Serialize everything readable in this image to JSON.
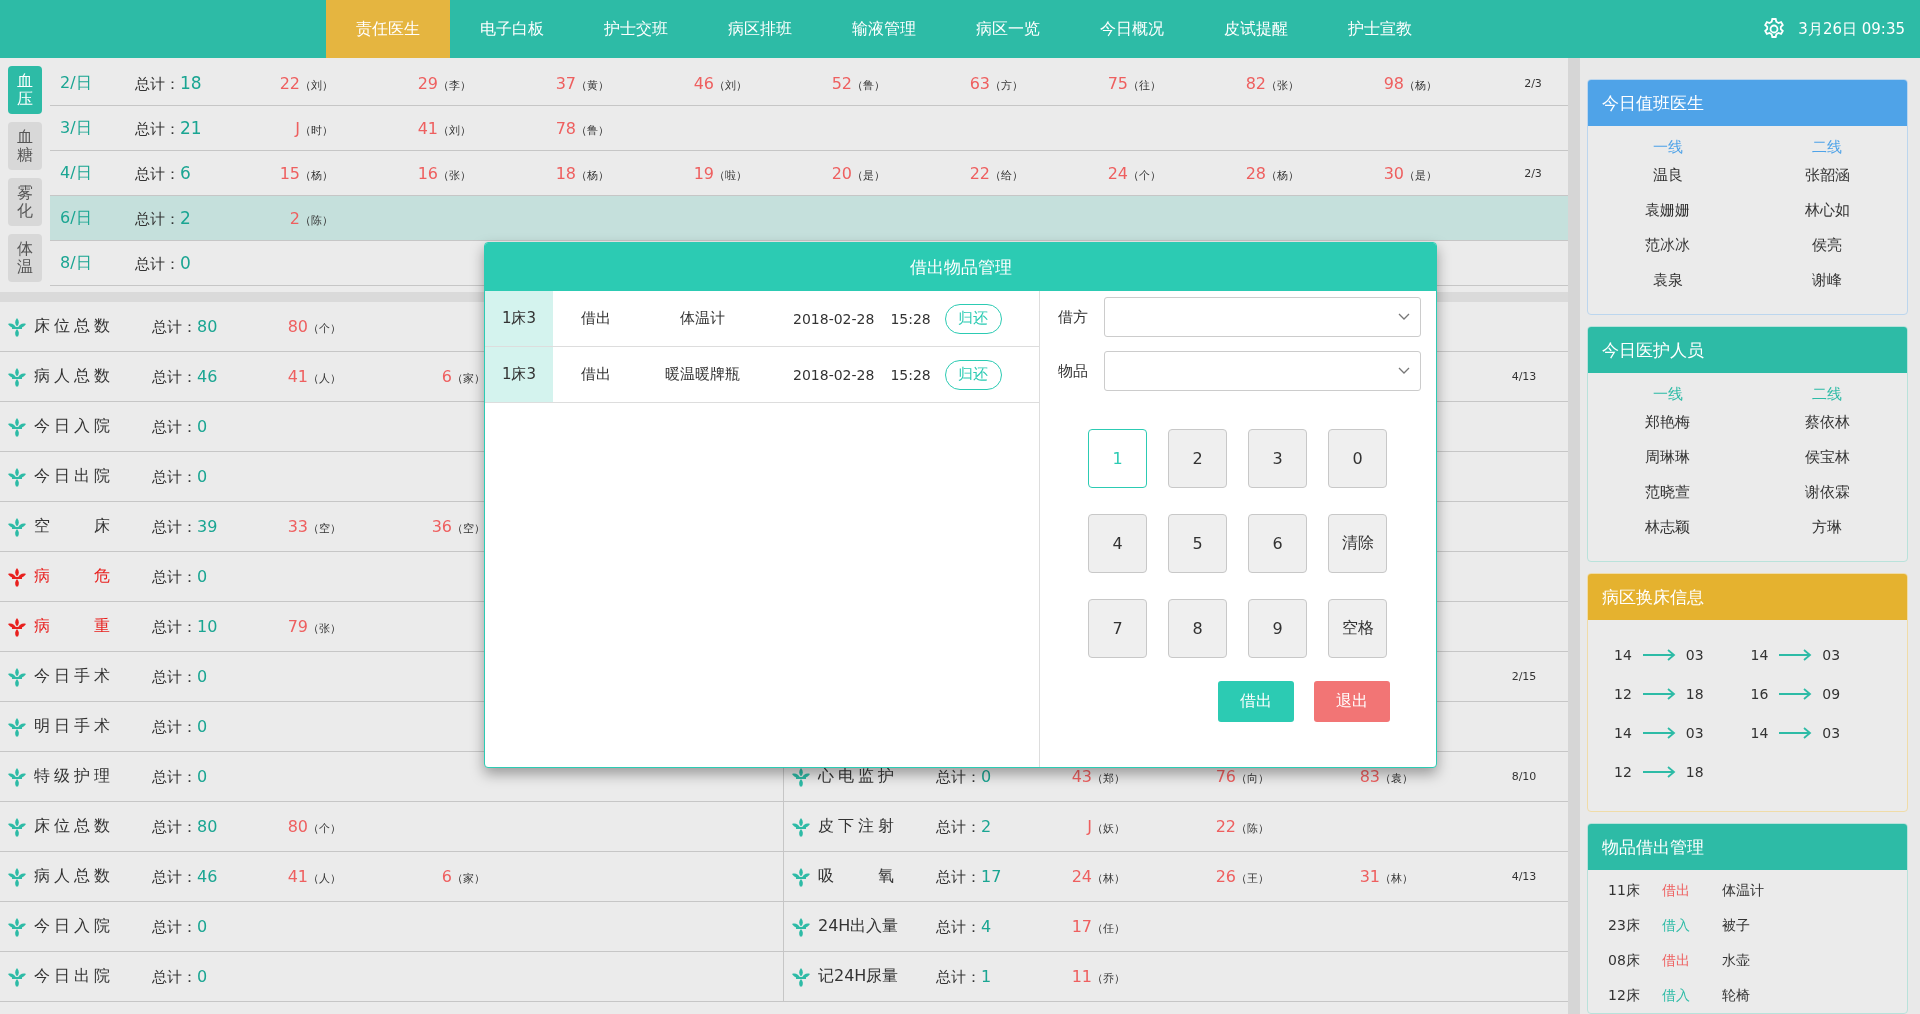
{
  "nav": {
    "tabs": [
      {
        "label": "责任医生",
        "selected": true
      },
      {
        "label": "电子白板",
        "selected": false
      },
      {
        "label": "护士交班",
        "selected": false
      },
      {
        "label": "病区排班",
        "selected": false
      },
      {
        "label": "输液管理",
        "selected": false
      },
      {
        "label": "病区一览",
        "selected": false
      },
      {
        "label": "今日概况",
        "selected": false
      },
      {
        "label": "皮试提醒",
        "selected": false
      },
      {
        "label": "护士宣教",
        "selected": false
      }
    ],
    "datetime": "3月26日 09:35"
  },
  "vitals": {
    "tabs": [
      {
        "label": "血压",
        "selected": true
      },
      {
        "label": "血糖",
        "selected": false
      },
      {
        "label": "雾化",
        "selected": false
      },
      {
        "label": "体温",
        "selected": false
      }
    ],
    "rows": [
      {
        "day": "2/日",
        "total_label": "总计：",
        "total": "18",
        "selected": false,
        "entries": [
          {
            "value": "22",
            "name": "（刘）"
          },
          {
            "value": "29",
            "name": "（李）"
          },
          {
            "value": "37",
            "name": "（黄）"
          },
          {
            "value": "46",
            "name": "（刘）"
          },
          {
            "value": "52",
            "name": "（鲁）"
          },
          {
            "value": "63",
            "name": "（方）"
          },
          {
            "value": "75",
            "name": "（往）"
          },
          {
            "value": "82",
            "name": "（张）"
          },
          {
            "value": "98",
            "name": "（杨）"
          }
        ],
        "page": "2/3"
      },
      {
        "day": "3/日",
        "total_label": "总计：",
        "total": "21",
        "selected": false,
        "entries": [
          {
            "value": "J",
            "name": "（时）"
          },
          {
            "value": "41",
            "name": "（刘）"
          },
          {
            "value": "78",
            "name": "（鲁）"
          }
        ]
      },
      {
        "day": "4/日",
        "total_label": "总计：",
        "total": "6",
        "selected": false,
        "entries": [
          {
            "value": "15",
            "name": "（杨）"
          },
          {
            "value": "16",
            "name": "（张）"
          },
          {
            "value": "18",
            "name": "（杨）"
          },
          {
            "value": "19",
            "name": "（啦）"
          },
          {
            "value": "20",
            "name": "（是）"
          },
          {
            "value": "22",
            "name": "（给）"
          },
          {
            "value": "24",
            "name": "（个）"
          },
          {
            "value": "28",
            "name": "（杨）"
          },
          {
            "value": "30",
            "name": "（是）"
          }
        ],
        "page": "2/3"
      },
      {
        "day": "6/日",
        "total_label": "总计：",
        "total": "2",
        "selected": true,
        "entries": [
          {
            "value": "2",
            "name": "（陈）"
          }
        ]
      },
      {
        "day": "8/日",
        "total_label": "总计：",
        "total": "0",
        "selected": false,
        "entries": []
      }
    ]
  },
  "summary": {
    "columns": [
      {
        "rows": [
          {
            "name": "床位总数",
            "critical": false,
            "total_label": "总计：",
            "total": "80",
            "entries": [
              {
                "value": "80",
                "name": "（个）"
              }
            ]
          },
          {
            "name": "病人总数",
            "critical": false,
            "total_label": "总计：",
            "total": "46",
            "entries": [
              {
                "value": "41",
                "name": "（人）"
              },
              {
                "value": "6",
                "name": "（家）"
              }
            ]
          },
          {
            "name": "今日入院",
            "critical": false,
            "total_label": "总计：",
            "total": "0",
            "entries": []
          },
          {
            "name": "今日出院",
            "critical": false,
            "total_label": "总计：",
            "total": "0",
            "entries": []
          },
          {
            "name": "空床",
            "critical": false,
            "total_label": "总计：",
            "total": "39",
            "entries": [
              {
                "value": "33",
                "name": "（空）"
              },
              {
                "value": "36",
                "name": "（空）"
              }
            ]
          },
          {
            "name": "病危",
            "critical": true,
            "total_label": "总计：",
            "total": "0",
            "entries": []
          },
          {
            "name": "病重",
            "critical": true,
            "total_label": "总计：",
            "total": "10",
            "entries": [
              {
                "value": "79",
                "name": "（张）"
              }
            ]
          },
          {
            "name": "今日手术",
            "critical": false,
            "total_label": "总计：",
            "total": "0",
            "entries": []
          },
          {
            "name": "明日手术",
            "critical": false,
            "total_label": "总计：",
            "total": "0",
            "entries": []
          },
          {
            "name": "特级护理",
            "critical": false,
            "total_label": "总计：",
            "total": "0",
            "entries": []
          },
          {
            "name": "床位总数",
            "critical": false,
            "total_label": "总计：",
            "total": "80",
            "entries": [
              {
                "value": "80",
                "name": "（个）"
              }
            ]
          },
          {
            "name": "病人总数",
            "critical": false,
            "total_label": "总计：",
            "total": "46",
            "entries": [
              {
                "value": "41",
                "name": "（人）"
              },
              {
                "value": "6",
                "name": "（家）"
              }
            ]
          },
          {
            "name": "今日入院",
            "critical": false,
            "total_label": "总计：",
            "total": "0",
            "entries": []
          },
          {
            "name": "今日出院",
            "critical": false,
            "total_label": "总计：",
            "total": "0",
            "entries": []
          }
        ]
      },
      {
        "rows": [
          {},
          {
            "page": "4/13"
          },
          {},
          {},
          {},
          {},
          {},
          {
            "page": "2/15"
          },
          {},
          {
            "name": "心电监护",
            "critical": false,
            "total_label": "总计：",
            "total": "0",
            "entries": [
              {
                "value": "43",
                "name": "（郑）"
              },
              {
                "value": "76",
                "name": "（向）"
              },
              {
                "value": "83",
                "name": "（袁）"
              }
            ],
            "page": "8/10"
          },
          {
            "name": "皮下注射",
            "critical": false,
            "total_label": "总计：",
            "total": "2",
            "entries": [
              {
                "value": "J",
                "name": "（妖）"
              },
              {
                "value": "22",
                "name": "（陈）"
              }
            ]
          },
          {
            "name": "吸氧",
            "critical": false,
            "total_label": "总计：",
            "total": "17",
            "entries": [
              {
                "value": "24",
                "name": "（林）"
              },
              {
                "value": "26",
                "name": "（王）"
              },
              {
                "value": "31",
                "name": "（林）"
              }
            ],
            "page": "4/13"
          },
          {
            "name": "24H出入量",
            "critical": false,
            "total_label": "总计：",
            "total": "4",
            "entries": [
              {
                "value": "17",
                "name": "（任）"
              }
            ]
          },
          {
            "name": "记24H尿量",
            "critical": false,
            "total_label": "总计：",
            "total": "1",
            "entries": [
              {
                "value": "11",
                "name": "（乔）"
              }
            ]
          }
        ]
      }
    ]
  },
  "dialog": {
    "title": "借出物品管理",
    "loans": [
      {
        "bed": "1床3",
        "action": "借出",
        "item": "体温计",
        "date": "2018-02-28",
        "time": "15:28",
        "button": "归还"
      },
      {
        "bed": "1床3",
        "action": "借出",
        "item": "暖温暖牌瓶",
        "date": "2018-02-28",
        "time": "15:28",
        "button": "归还"
      }
    ],
    "fields": [
      {
        "label": "借方"
      },
      {
        "label": "物品"
      }
    ],
    "keys": [
      {
        "label": "1",
        "selected": true
      },
      {
        "label": "2",
        "selected": false
      },
      {
        "label": "3",
        "selected": false
      },
      {
        "label": "0",
        "selected": false
      },
      {
        "label": "4",
        "selected": false
      },
      {
        "label": "5",
        "selected": false
      },
      {
        "label": "6",
        "selected": false
      },
      {
        "label": "清除",
        "selected": false
      },
      {
        "label": "7",
        "selected": false
      },
      {
        "label": "8",
        "selected": false
      },
      {
        "label": "9",
        "selected": false
      },
      {
        "label": "空格",
        "selected": false
      }
    ],
    "buttons": [
      {
        "label": "借出",
        "kind": "primary"
      },
      {
        "label": "退出",
        "kind": "danger"
      }
    ]
  },
  "duty_doctors": {
    "title": "今日值班医生",
    "columns": [
      {
        "heading": "一线",
        "names": [
          "温良",
          "袁姗姗",
          "范冰冰",
          "袁泉"
        ]
      },
      {
        "heading": "二线",
        "names": [
          "张韶涵",
          "林心如",
          "侯亮",
          "谢峰"
        ]
      }
    ]
  },
  "staff": {
    "title": "今日医护人员",
    "columns": [
      {
        "heading": "一线",
        "names": [
          "郑艳梅",
          "周琳琳",
          "范晓萱",
          "林志颖"
        ]
      },
      {
        "heading": "二线",
        "names": [
          "蔡依林",
          "侯宝林",
          "谢依霖",
          "方琳"
        ]
      }
    ]
  },
  "bed_changes": {
    "title": "病区换床信息",
    "items": [
      {
        "from": "14",
        "to": "03"
      },
      {
        "from": "14",
        "to": "03"
      },
      {
        "from": "12",
        "to": "18"
      },
      {
        "from": "16",
        "to": "09"
      },
      {
        "from": "14",
        "to": "03"
      },
      {
        "from": "14",
        "to": "03"
      },
      {
        "from": "12",
        "to": "18"
      }
    ]
  },
  "loans": {
    "title": "物品借出管理",
    "items": [
      {
        "bed": "11床",
        "kind": "out",
        "action": "借出",
        "item": "体温计"
      },
      {
        "bed": "23床",
        "kind": "in",
        "action": "借入",
        "item": "被子"
      },
      {
        "bed": "08床",
        "kind": "out",
        "action": "借出",
        "item": "水壶"
      },
      {
        "bed": "12床",
        "kind": "in",
        "action": "借入",
        "item": "轮椅"
      }
    ]
  }
}
